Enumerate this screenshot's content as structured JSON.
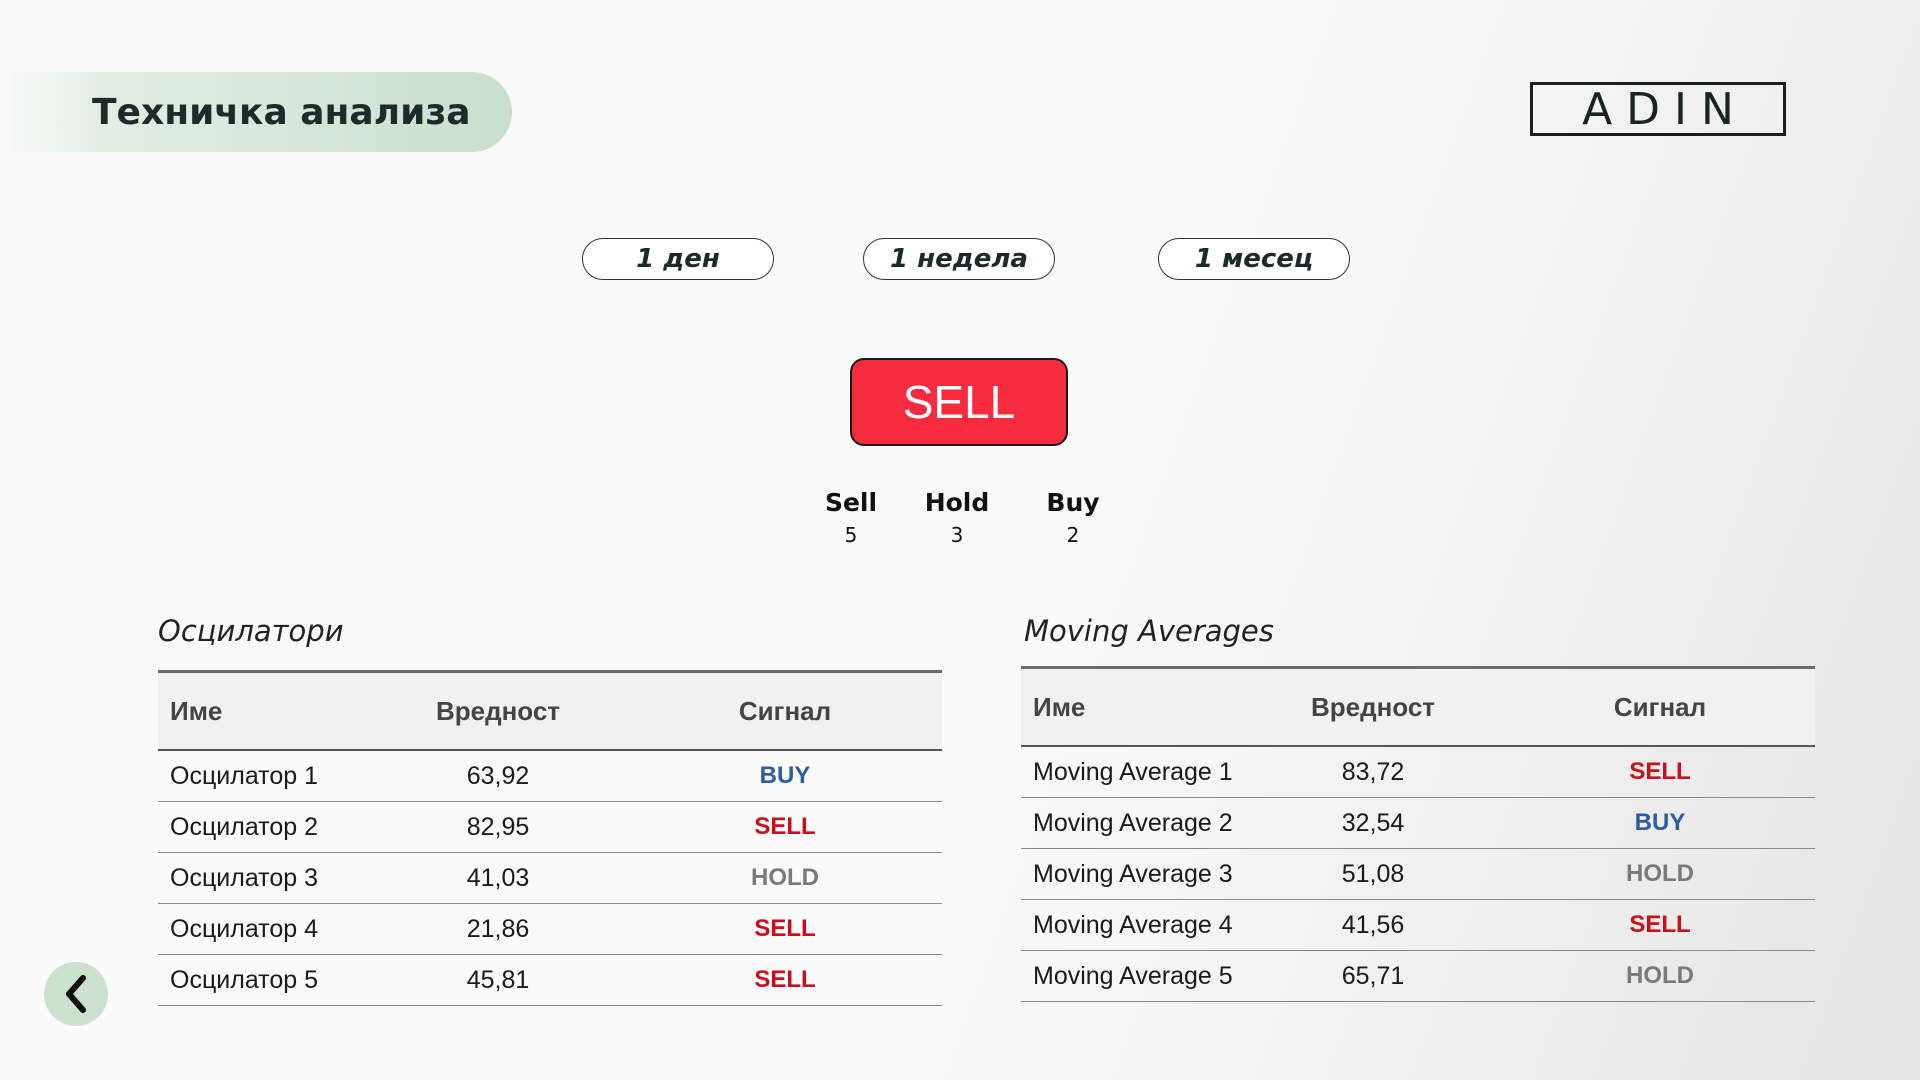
{
  "header": {
    "title": "Техничка анализа",
    "logo_text": "ADIN"
  },
  "periods": [
    "1 ден",
    "1 недела",
    "1 месец"
  ],
  "summary": {
    "signal": "SELL",
    "counts": [
      {
        "label": "Sell",
        "value": "5"
      },
      {
        "label": "Hold",
        "value": "3"
      },
      {
        "label": "Buy",
        "value": "2"
      }
    ]
  },
  "oscillators": {
    "title": "Осцилатори",
    "columns": [
      "Име",
      "Вредност",
      "Сигнал"
    ],
    "rows": [
      {
        "name": "Осцилатор 1",
        "value": "63,92",
        "signal": "BUY"
      },
      {
        "name": "Осцилатор 2",
        "value": "82,95",
        "signal": "SELL"
      },
      {
        "name": "Осцилатор 3",
        "value": "41,03",
        "signal": "HOLD"
      },
      {
        "name": "Осцилатор 4",
        "value": "21,86",
        "signal": "SELL"
      },
      {
        "name": "Осцилатор 5",
        "value": "45,81",
        "signal": "SELL"
      }
    ]
  },
  "moving_averages": {
    "title": "Moving Averages",
    "columns": [
      "Име",
      "Вредност",
      "Сигнал"
    ],
    "rows": [
      {
        "name": "Moving Average 1",
        "value": "83,72",
        "signal": "SELL"
      },
      {
        "name": "Moving Average 2",
        "value": "32,54",
        "signal": "BUY"
      },
      {
        "name": "Moving Average 3",
        "value": "51,08",
        "signal": "HOLD"
      },
      {
        "name": "Moving Average 4",
        "value": "41,56",
        "signal": "SELL"
      },
      {
        "name": "Moving Average 5",
        "value": "65,71",
        "signal": "HOLD"
      }
    ]
  },
  "colors": {
    "sell_button": "#f72b3e",
    "buy_text": "#2e5c9e",
    "sell_text": "#c8101d",
    "hold_text": "#7a7a7a",
    "accent_green": "#c9dfcd"
  },
  "icons": {
    "back": "chevron-left-icon"
  }
}
